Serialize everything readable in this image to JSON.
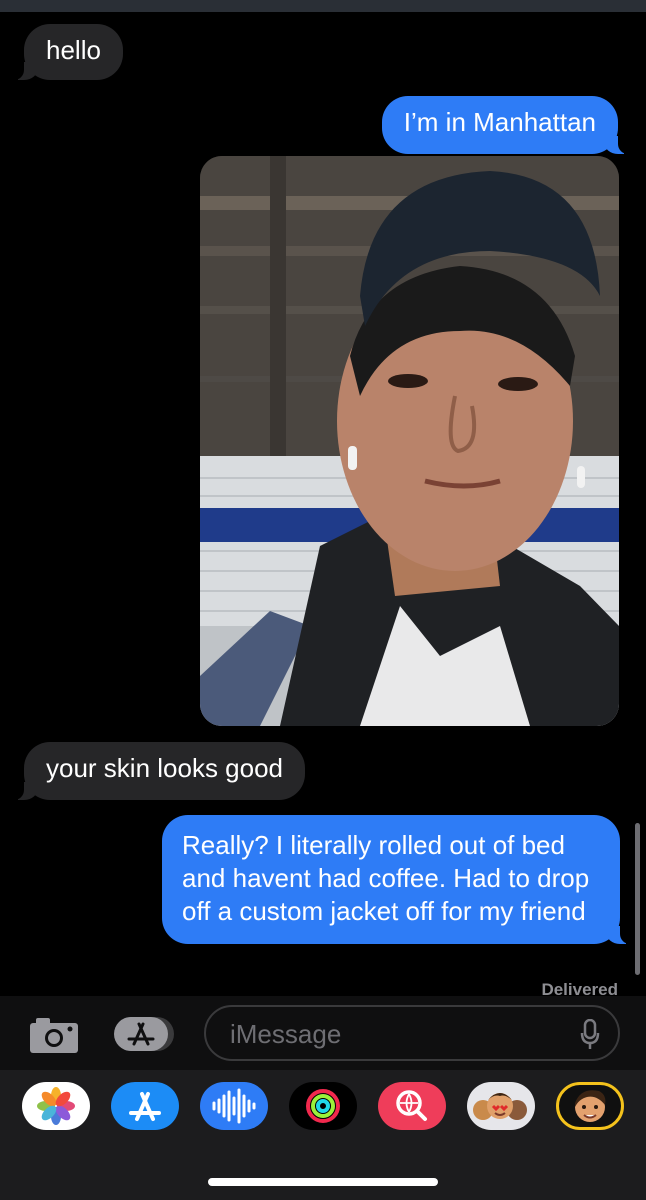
{
  "messages": {
    "hello": "hello",
    "manhattan": "I’m in Manhattan",
    "skin": "your skin looks good",
    "really": "Really? I literally rolled out of bed and havent had coffee. Had to drop off a custom jacket off for my friend"
  },
  "status": {
    "delivered": "Delivered"
  },
  "compose": {
    "placeholder": "iMessage"
  },
  "app_drawer": [
    "photos-app",
    "app-store-app",
    "audio-message-app",
    "activity-app",
    "image-search-app",
    "memoji-stickers-app",
    "memoji-app"
  ],
  "colors": {
    "sent": "#2e7cf6",
    "received": "#262628",
    "background": "#000000"
  }
}
